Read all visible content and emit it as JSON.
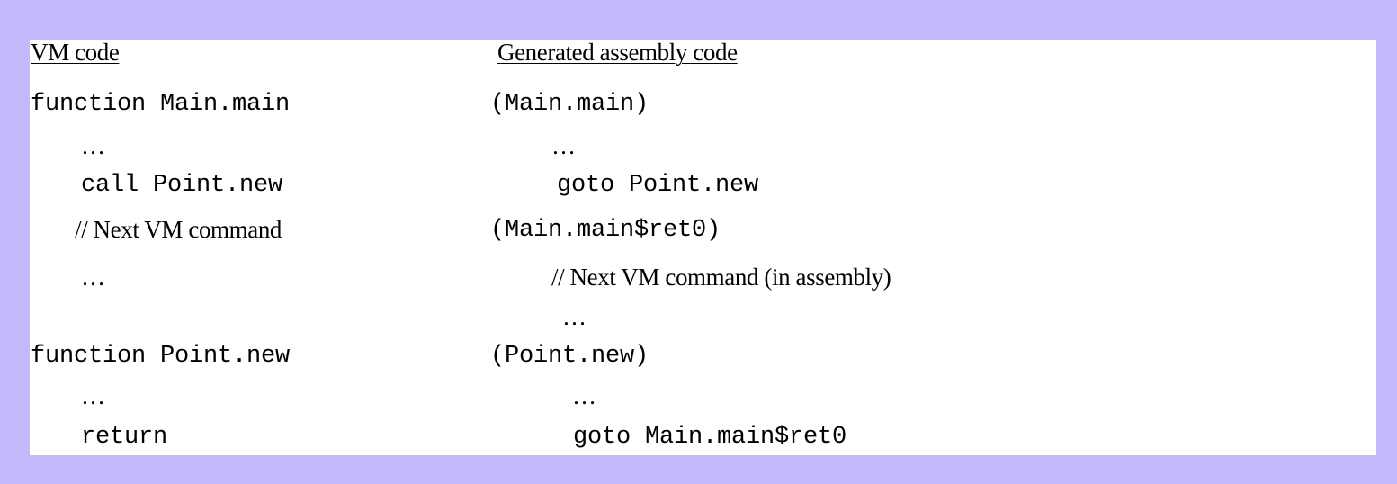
{
  "headers": {
    "vm": "VM code",
    "asm": "Generated assembly code"
  },
  "vm": [
    "function Main.main",
    "…",
    "call Point.new",
    "// Next VM command",
    "…",
    "function Point.new",
    "…",
    "return"
  ],
  "asm": [
    "(Main.main)",
    "…",
    "goto Point.new",
    "(Main.main$ret0)",
    "// Next VM command (in assembly)",
    "…",
    "(Point.new)",
    "…",
    "goto Main.main$ret0"
  ]
}
